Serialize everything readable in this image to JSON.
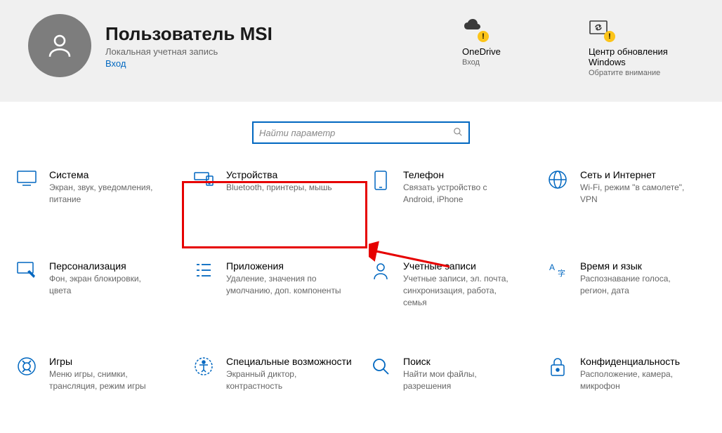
{
  "user": {
    "name": "Пользователь MSI",
    "account_type": "Локальная учетная запись",
    "signin_label": "Вход"
  },
  "header_tiles": {
    "onedrive": {
      "title": "OneDrive",
      "sub": "Вход"
    },
    "update": {
      "title": "Центр обновления Windows",
      "sub": "Обратите внимание"
    }
  },
  "search": {
    "placeholder": "Найти параметр"
  },
  "categories": {
    "system": {
      "title": "Система",
      "desc": "Экран, звук, уведомления, питание"
    },
    "devices": {
      "title": "Устройства",
      "desc": "Bluetooth, принтеры, мышь"
    },
    "phone": {
      "title": "Телефон",
      "desc": "Связать устройство с Android, iPhone"
    },
    "network": {
      "title": "Сеть и Интернет",
      "desc": "Wi-Fi, режим \"в самолете\", VPN"
    },
    "personal": {
      "title": "Персонализация",
      "desc": "Фон, экран блокировки, цвета"
    },
    "apps": {
      "title": "Приложения",
      "desc": "Удаление, значения по умолчанию, доп. компоненты"
    },
    "accounts": {
      "title": "Учетные записи",
      "desc": "Учетные записи, эл. почта, синхронизация, работа, семья"
    },
    "time": {
      "title": "Время и язык",
      "desc": "Распознавание голоса, регион, дата"
    },
    "gaming": {
      "title": "Игры",
      "desc": "Меню игры, снимки, трансляция, режим игры"
    },
    "ease": {
      "title": "Специальные возможности",
      "desc": "Экранный диктор, контрастность"
    },
    "searchcat": {
      "title": "Поиск",
      "desc": "Найти мои файлы, разрешения"
    },
    "privacy": {
      "title": "Конфиденциальность",
      "desc": "Расположение, камера, микрофон"
    }
  },
  "annotation": {
    "arrow_color": "#e60000"
  }
}
